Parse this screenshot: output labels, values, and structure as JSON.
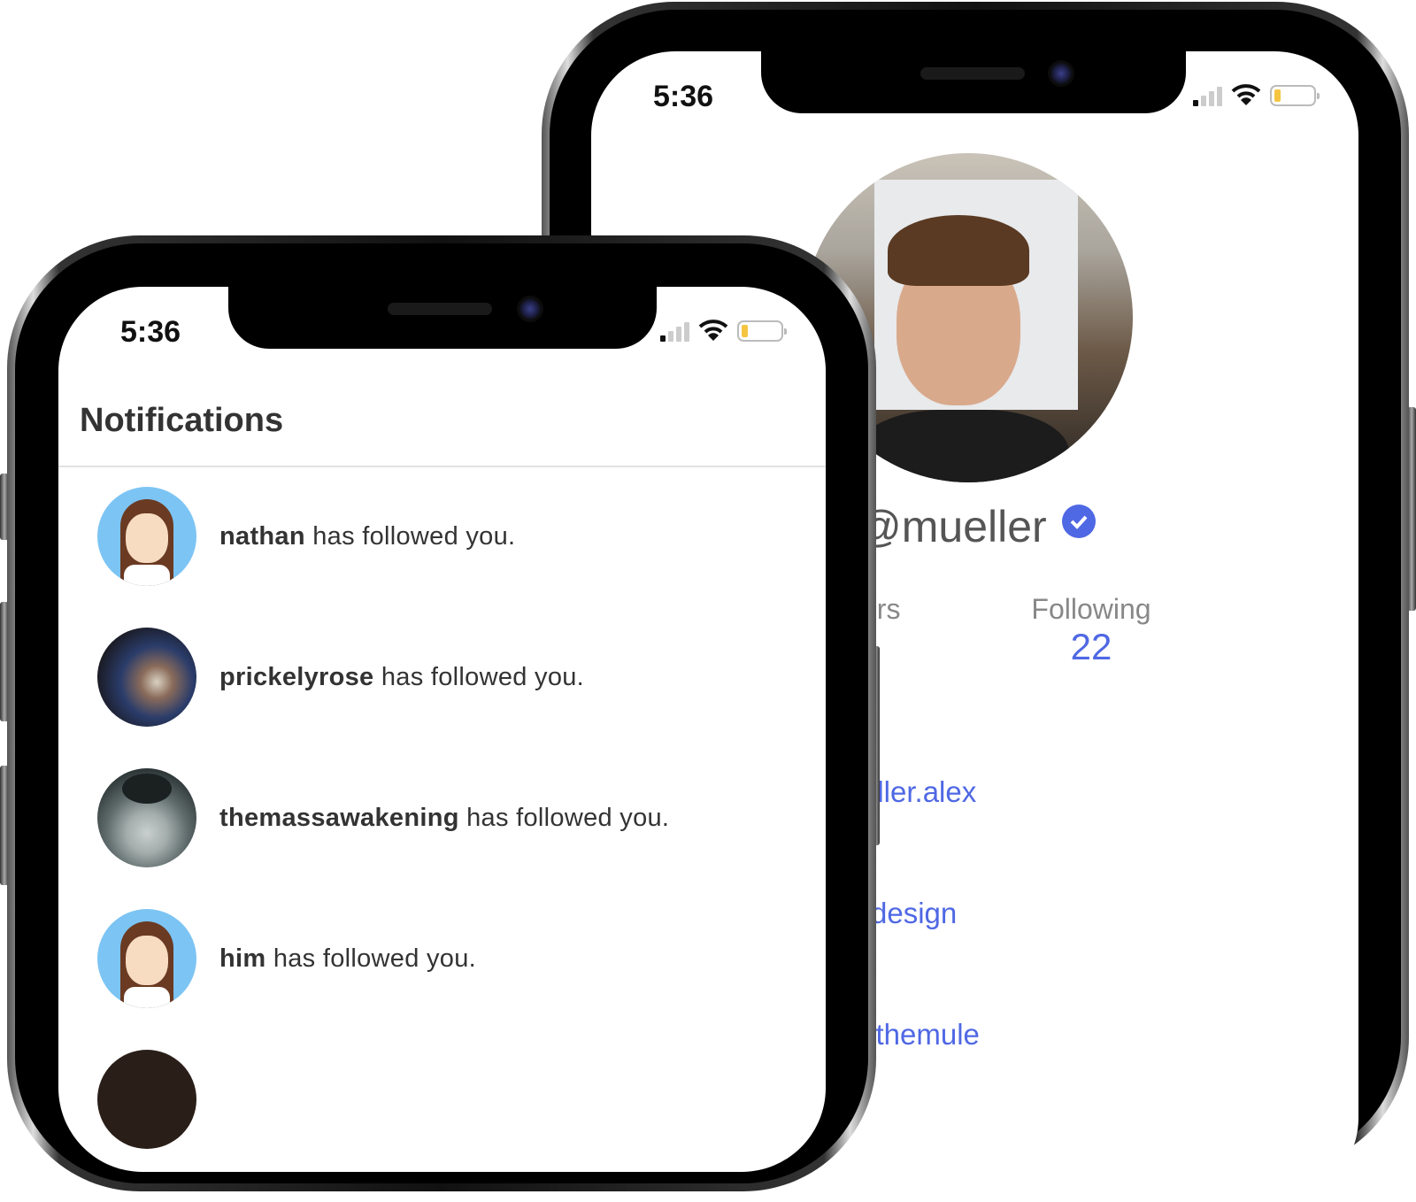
{
  "back_phone": {
    "status": {
      "time": "5:36"
    },
    "profile": {
      "username": "@mueller",
      "verified": true,
      "stats": [
        {
          "label": "ers"
        },
        {
          "label": "Following",
          "value": "22"
        }
      ],
      "links": [
        "eller.alex",
        "rdesign",
        "xthemule"
      ]
    }
  },
  "front_phone": {
    "status": {
      "time": "5:36"
    },
    "header": {
      "title": "Notifications"
    },
    "notifications": [
      {
        "user": "nathan",
        "text": " has followed you.",
        "avatar": "cartoon-girl"
      },
      {
        "user": "prickelyrose",
        "text": " has followed you.",
        "avatar": "photo"
      },
      {
        "user": "themassawakening",
        "text": " has followed you.",
        "avatar": "photo-man"
      },
      {
        "user": "him",
        "text": " has followed you.",
        "avatar": "cartoon-girl"
      }
    ]
  },
  "colors": {
    "accent": "#4f68e4",
    "battery": "#f5c542",
    "text": "#333333"
  }
}
